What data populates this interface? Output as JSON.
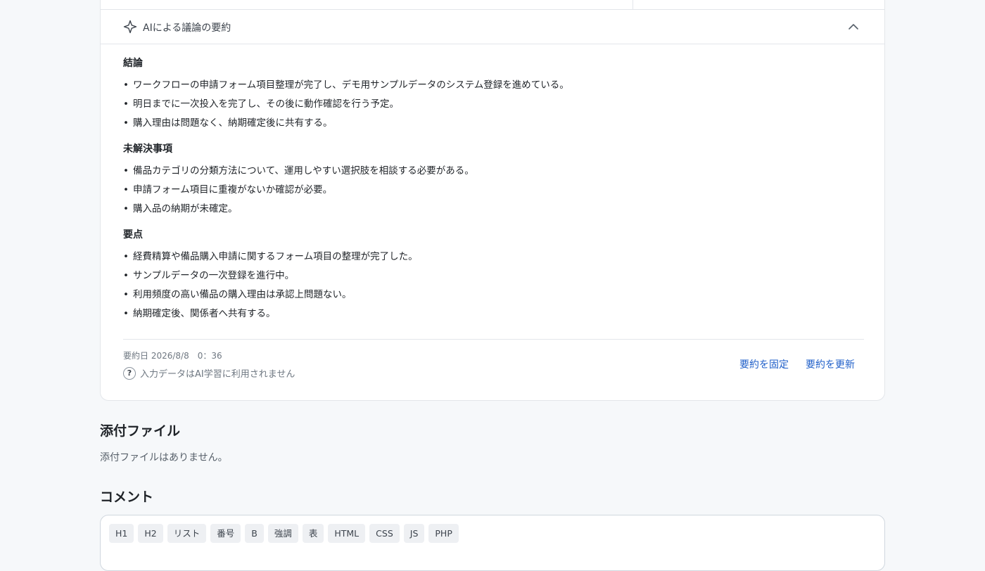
{
  "summary": {
    "header_title": "AIによる議論の要約",
    "sections": [
      {
        "title": "結論",
        "items": [
          "ワークフローの申請フォーム項目整理が完了し、デモ用サンプルデータのシステム登録を進めている。",
          "明日までに一次投入を完了し、その後に動作確認を行う予定。",
          "購入理由は問題なく、納期確定後に共有する。"
        ]
      },
      {
        "title": "未解決事項",
        "items": [
          "備品カテゴリの分類方法について、運用しやすい選択肢を相談する必要がある。",
          "申請フォーム項目に重複がないか確認が必要。",
          "購入品の納期が未確定。"
        ]
      },
      {
        "title": "要点",
        "items": [
          "経費精算や備品購入申請に関するフォーム項目の整理が完了した。",
          "サンプルデータの一次登録を進行中。",
          "利用頻度の高い備品の購入理由は承認上問題ない。",
          "納期確定後、関係者へ共有する。"
        ]
      }
    ],
    "date_line": "要約日 2026/8/8　0：36",
    "notice": "入力データはAI学習に利用されません",
    "notice_icon": "?",
    "pin_label": "要約を固定",
    "refresh_label": "要約を更新"
  },
  "attachments": {
    "title": "添付ファイル",
    "empty_text": "添付ファイルはありません。"
  },
  "comments": {
    "title": "コメント",
    "toolbar": [
      "H1",
      "H2",
      "リスト",
      "番号",
      "B",
      "強調",
      "表",
      "HTML",
      "CSS",
      "JS",
      "PHP"
    ]
  },
  "colors": {
    "link": "#1f5fc9",
    "background": "#f6f8fa",
    "card": "#ffffff"
  },
  "icons": {
    "header": "sparkle-icon",
    "collapse": "chevron-up-icon",
    "notice": "question-circle-icon"
  }
}
